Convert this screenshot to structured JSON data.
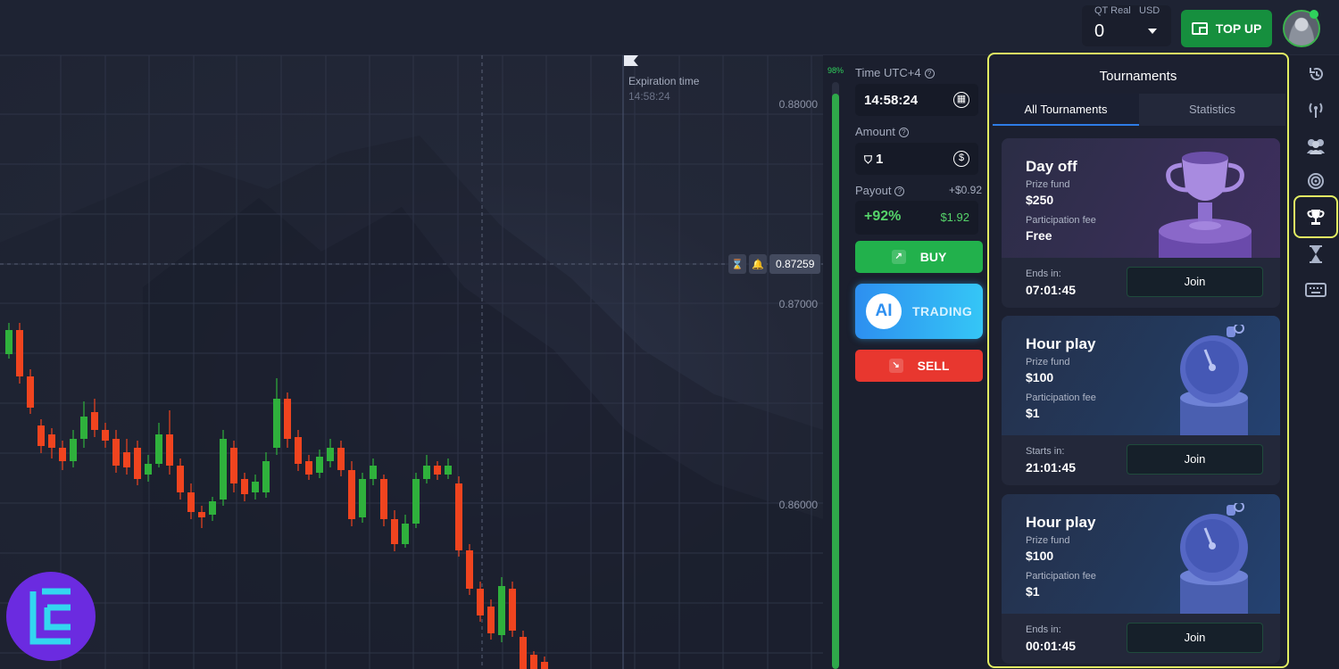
{
  "header": {
    "account_type": "QT Real",
    "currency": "USD",
    "balance": "0",
    "topup_label": "TOP UP"
  },
  "chart": {
    "expiration_label": "Expiration time",
    "expiration_time": "14:58:24",
    "price_ticks": [
      "0.88000",
      "0.87000",
      "0.86000"
    ],
    "current_price": "0.87259",
    "up_color": "#2fb13c",
    "down_color": "#f0441f"
  },
  "sentiment": {
    "percent_label": "98%",
    "value": 98,
    "color": "#2fa84a"
  },
  "trade": {
    "time_label": "Time UTC+4",
    "time_value": "14:58:24",
    "amount_label": "Amount",
    "amount_value": "1",
    "payout_label": "Payout",
    "payout_gain": "+$0.92",
    "payout_percent": "+92%",
    "payout_amount": "$1.92",
    "buy_label": "BUY",
    "ai_badge": "AI",
    "ai_label": "TRADING",
    "sell_label": "SELL"
  },
  "tournaments": {
    "title": "Tournaments",
    "tabs": [
      "All Tournaments",
      "Statistics"
    ],
    "prize_fund_label": "Prize fund",
    "fee_label": "Participation fee",
    "join_label": "Join",
    "cards": [
      {
        "name": "Day off",
        "prize": "$250",
        "fee": "Free",
        "time_label": "Ends in:",
        "time": "07:01:45",
        "art": "trophy-icon"
      },
      {
        "name": "Hour play",
        "prize": "$100",
        "fee": "$1",
        "time_label": "Starts in:",
        "time": "21:01:45",
        "art": "stopwatch-icon"
      },
      {
        "name": "Hour play",
        "prize": "$100",
        "fee": "$1",
        "time_label": "Ends in:",
        "time": "00:01:45",
        "art": "stopwatch-icon"
      }
    ]
  },
  "rail": {
    "icons": [
      "history-icon",
      "signals-icon",
      "social-trading-icon",
      "target-icon",
      "trophy-icon",
      "hourglass-icon",
      "keyboard-icon"
    ],
    "active": "trophy-icon"
  }
}
